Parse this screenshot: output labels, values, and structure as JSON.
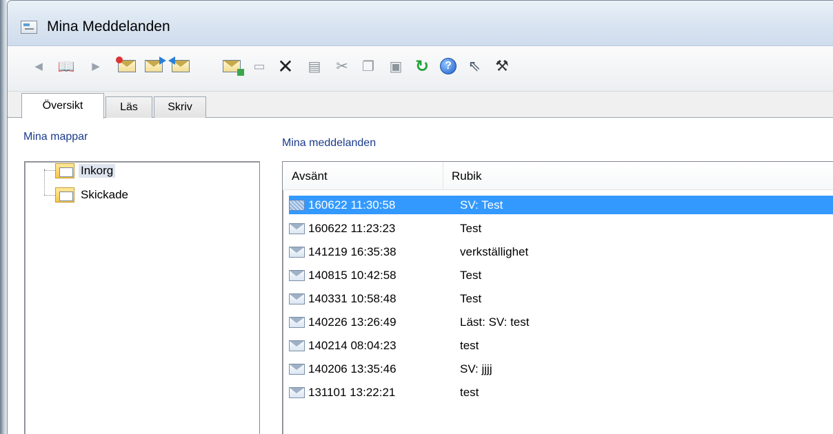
{
  "window": {
    "title": "Mina Meddelanden"
  },
  "toolbar": {
    "icons": [
      "back-arrow-icon",
      "book-icon",
      "forward-arrow-icon",
      "new-message-icon",
      "reply-icon",
      "forward-message-icon",
      "move-message-icon",
      "mark-icon",
      "delete-icon",
      "print-icon",
      "cut-icon",
      "copy-icon",
      "paste-icon",
      "refresh-icon",
      "help-icon",
      "whats-this-icon",
      "settings-icon"
    ]
  },
  "tabs": [
    {
      "label": "Översikt",
      "active": true
    },
    {
      "label": "Läs",
      "active": false
    },
    {
      "label": "Skriv",
      "active": false
    }
  ],
  "folders": {
    "title": "Mina mappar",
    "items": [
      {
        "label": "Inkorg",
        "selected": true
      },
      {
        "label": "Skickade",
        "selected": false
      }
    ]
  },
  "messages": {
    "title": "Mina meddelanden",
    "columns": [
      "Avsänt",
      "Rubik"
    ],
    "rows": [
      {
        "sent": "160622 11:30:58",
        "subject": "SV: Test",
        "selected": true
      },
      {
        "sent": "160622 11:23:23",
        "subject": "Test",
        "selected": false
      },
      {
        "sent": "141219 16:35:38",
        "subject": "verkställighet",
        "selected": false
      },
      {
        "sent": "140815 10:42:58",
        "subject": "Test",
        "selected": false
      },
      {
        "sent": "140331 10:58:48",
        "subject": "Test",
        "selected": false
      },
      {
        "sent": "140226 13:26:49",
        "subject": "Läst: SV: test",
        "selected": false
      },
      {
        "sent": "140214 08:04:23",
        "subject": "test",
        "selected": false
      },
      {
        "sent": "140206 13:35:46",
        "subject": "SV: jjjj",
        "selected": false
      },
      {
        "sent": "131101 13:22:21",
        "subject": "test",
        "selected": false
      }
    ]
  },
  "colors": {
    "selection": "#3399ff",
    "section_title": "#1a3a8a",
    "highlight_underline": "#e0201d"
  }
}
